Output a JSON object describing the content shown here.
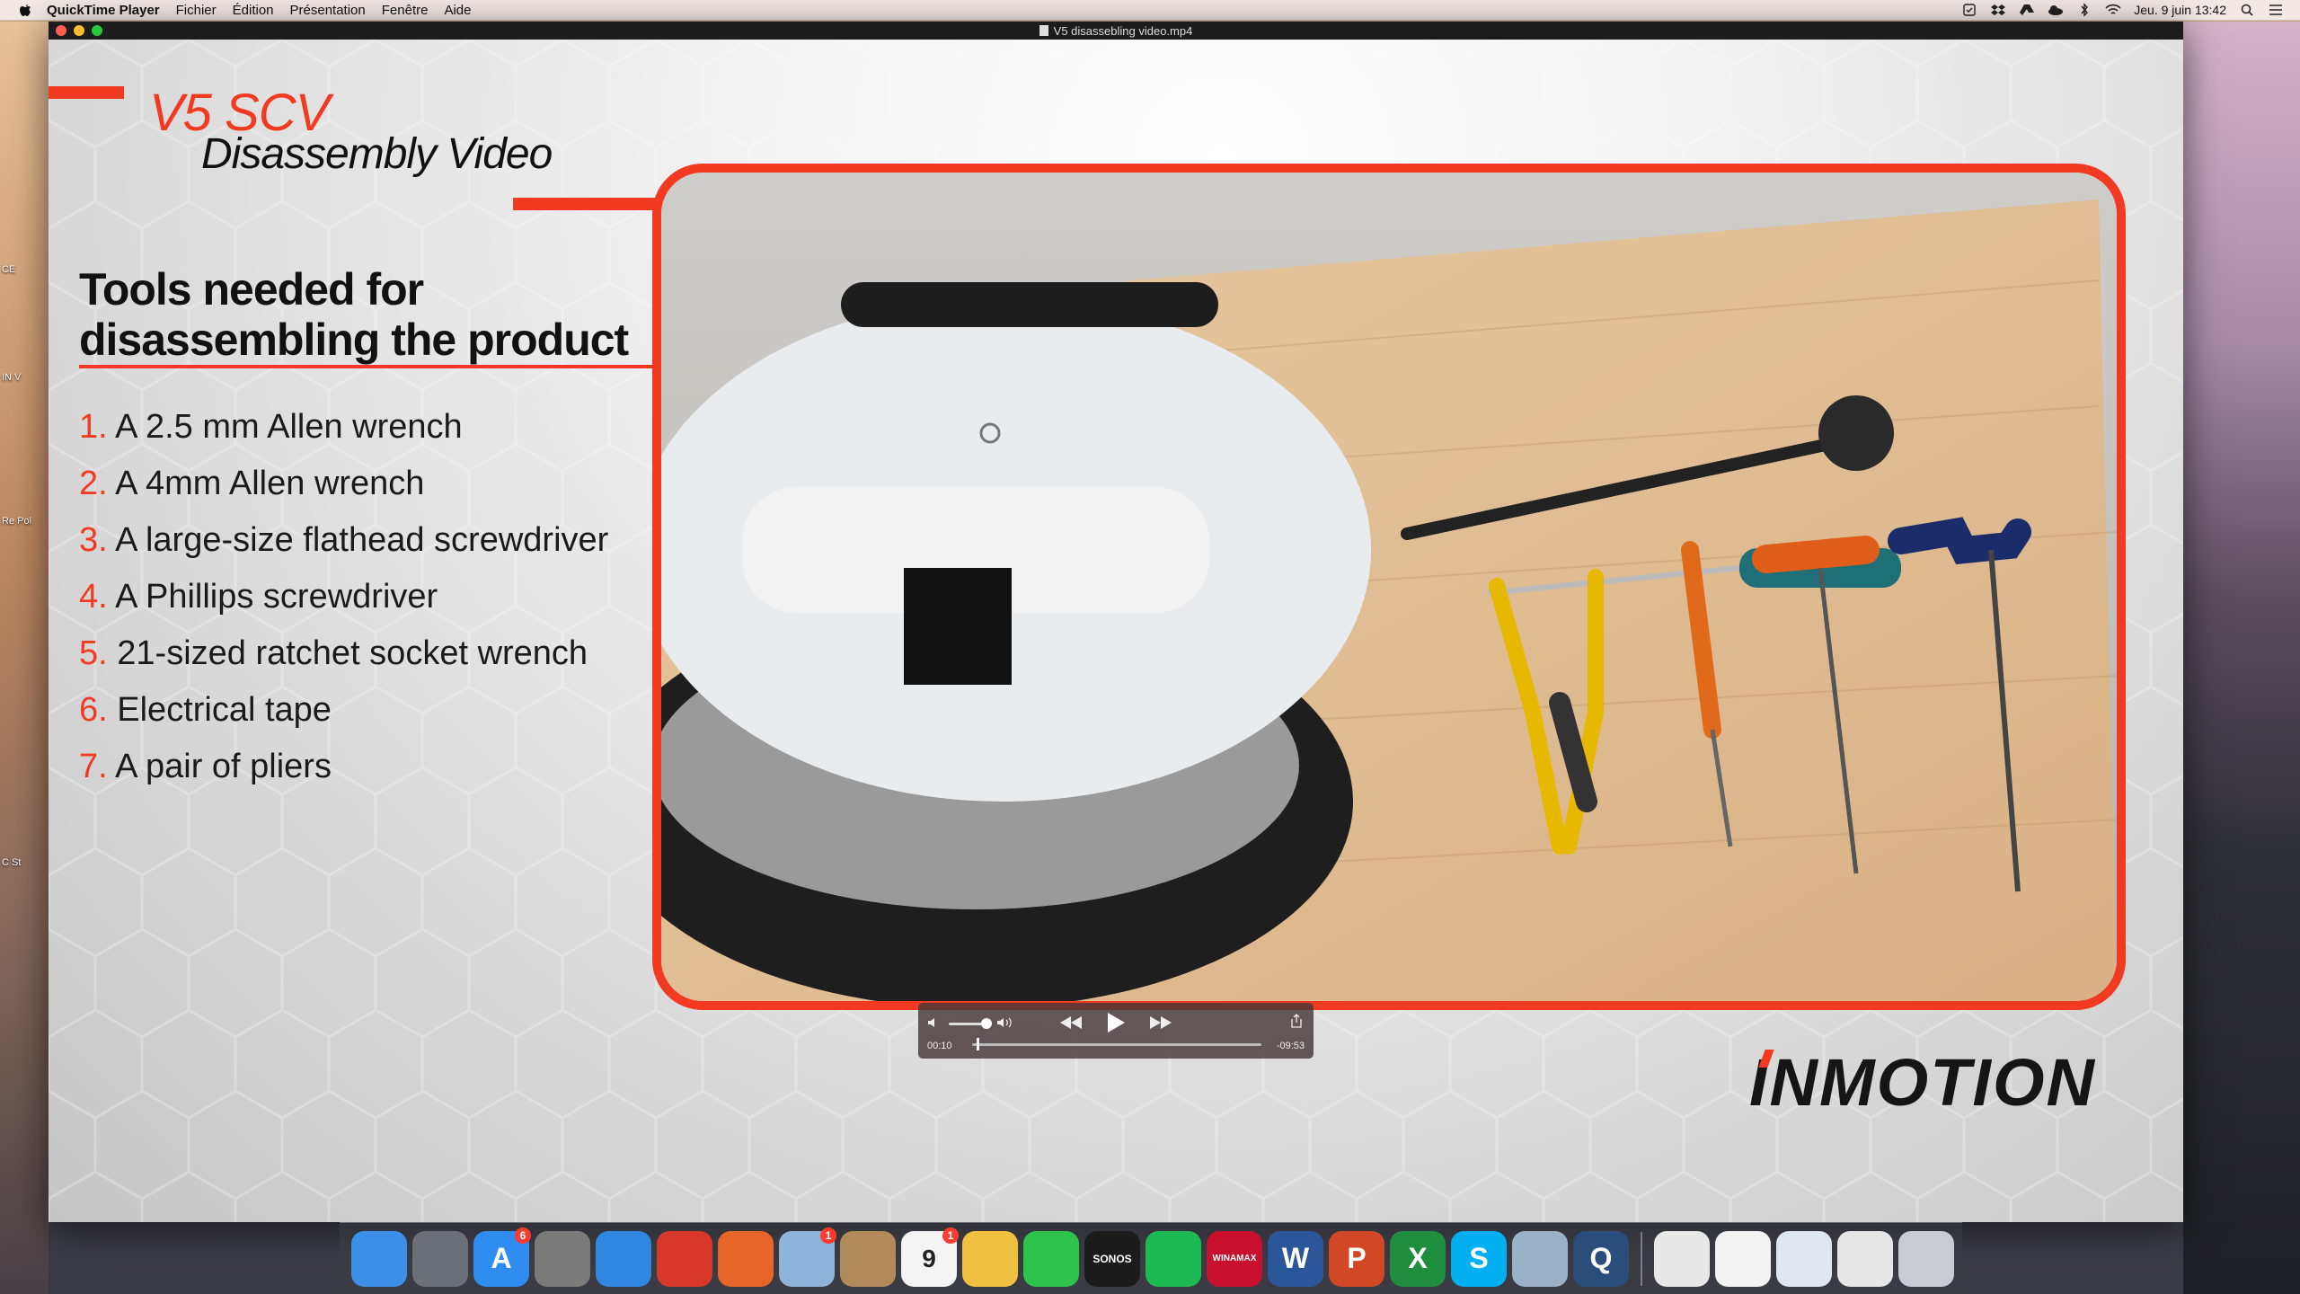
{
  "menubar": {
    "app_name": "QuickTime Player",
    "items": [
      "Fichier",
      "Édition",
      "Présentation",
      "Fenêtre",
      "Aide"
    ],
    "clock": "Jeu. 9 juin  13:42",
    "status_icons": [
      "checklist-icon",
      "dropbox-icon",
      "drive-icon",
      "cloud-icon",
      "bluetooth-icon",
      "wifi-icon",
      "search-icon",
      "list-icon"
    ]
  },
  "desktop": {
    "labels": [
      "CE",
      "IN V",
      "Re Pol",
      "C St"
    ]
  },
  "window": {
    "title": "V5 disassebling video.mp4"
  },
  "slide": {
    "title_line1": "V5 SCV",
    "title_line2": "Disassembly Video",
    "heading_line1": "Tools needed for",
    "heading_line2": "disassembling the product",
    "tools": [
      {
        "num": "1.",
        "text": "A 2.5 mm Allen wrench"
      },
      {
        "num": "2.",
        "text": "A 4mm Allen wrench"
      },
      {
        "num": "3.",
        "text": "A large-size flathead screwdriver"
      },
      {
        "num": "4.",
        "text": "A Phillips screwdriver"
      },
      {
        "num": "5.",
        "text": "21-sized ratchet socket wrench"
      },
      {
        "num": "6.",
        "text": "Electrical tape"
      },
      {
        "num": "7.",
        "text": "A pair of pliers"
      }
    ],
    "logo": "INMOTION",
    "accent_color": "#f23a22"
  },
  "player": {
    "elapsed": "00:10",
    "remaining": "-09:53",
    "volume_level": 0.85,
    "progress": 0.017
  },
  "dock": {
    "apps": [
      {
        "name": "finder",
        "label": "",
        "color": "#3b8fe6"
      },
      {
        "name": "launchpad",
        "label": "",
        "color": "#6b6f78"
      },
      {
        "name": "app-store",
        "label": "A",
        "color": "#2f8cf0",
        "badge": "6"
      },
      {
        "name": "system-preferences",
        "label": "",
        "color": "#7a7a7a"
      },
      {
        "name": "safari",
        "label": "",
        "color": "#2e86de"
      },
      {
        "name": "chrome",
        "label": "",
        "color": "#d7382a"
      },
      {
        "name": "firefox",
        "label": "",
        "color": "#e8652a"
      },
      {
        "name": "mail",
        "label": "",
        "color": "#8fb4d9",
        "badge": "1"
      },
      {
        "name": "contacts",
        "label": "",
        "color": "#b08a58"
      },
      {
        "name": "calendar",
        "label": "9",
        "color": "#f4f4f4",
        "badge": "1"
      },
      {
        "name": "photos",
        "label": "",
        "color": "#f0c040"
      },
      {
        "name": "facetime",
        "label": "",
        "color": "#2cc24c"
      },
      {
        "name": "sonos",
        "label": "SONOS",
        "color": "#1b1b1b"
      },
      {
        "name": "spotify",
        "label": "",
        "color": "#1db954"
      },
      {
        "name": "winamax",
        "label": "WINAMAX",
        "color": "#c8102e"
      },
      {
        "name": "word",
        "label": "W",
        "color": "#2b579a"
      },
      {
        "name": "powerpoint",
        "label": "P",
        "color": "#d24726"
      },
      {
        "name": "excel",
        "label": "X",
        "color": "#1e8e3e"
      },
      {
        "name": "skype",
        "label": "S",
        "color": "#00aff0"
      },
      {
        "name": "preview",
        "label": "",
        "color": "#9bb1c8"
      },
      {
        "name": "quicktime",
        "label": "Q",
        "color": "#2a4d7c"
      }
    ],
    "docs": [
      {
        "name": "doc-pdf",
        "color": "#e8e8e8"
      },
      {
        "name": "doc-scan",
        "color": "#f2f2f2"
      },
      {
        "name": "doc-window1",
        "color": "#dfe6ee"
      },
      {
        "name": "doc-window2",
        "color": "#e6e6e6"
      },
      {
        "name": "trash",
        "color": "#c9ccd2"
      }
    ]
  }
}
